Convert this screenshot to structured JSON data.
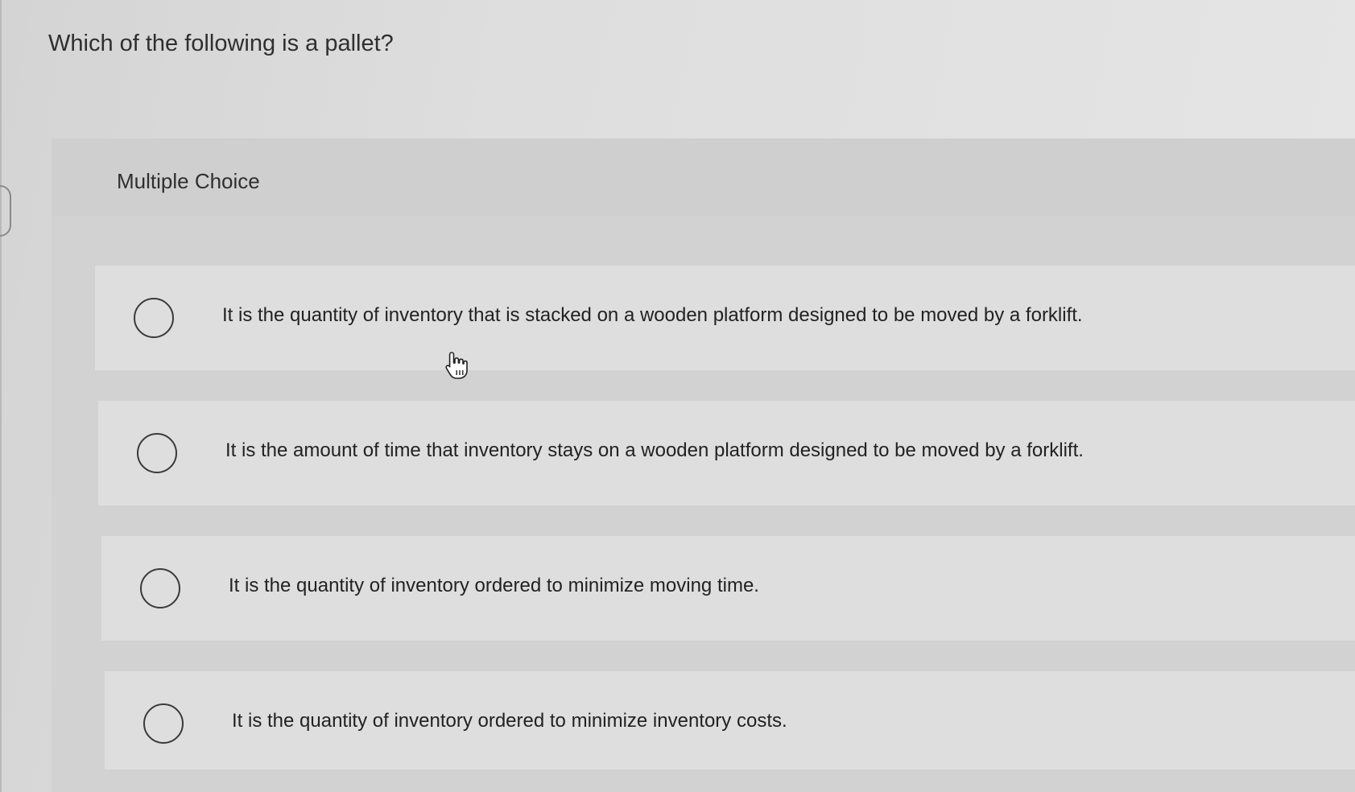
{
  "question": {
    "text": "Which of the following is a pallet?"
  },
  "multiple_choice": {
    "label": "Multiple Choice",
    "options": [
      {
        "text": "It is the quantity of inventory that is stacked on a wooden platform designed to be moved by a forklift.",
        "selected": false
      },
      {
        "text": "It is the amount of time that inventory stays on a wooden platform designed to be moved by a forklift.",
        "selected": false
      },
      {
        "text": "It is the quantity of inventory ordered to minimize moving time.",
        "selected": false
      },
      {
        "text": "It is the quantity of inventory ordered to minimize inventory costs.",
        "selected": false
      }
    ]
  },
  "icons": {
    "pointer": "hand-pointer-icon",
    "radio": "radio-button-icon"
  },
  "colors": {
    "background": "#dcdcdc",
    "panel": "#d2d2d2",
    "option_row": "#dedede",
    "text": "#2a2a2a"
  }
}
